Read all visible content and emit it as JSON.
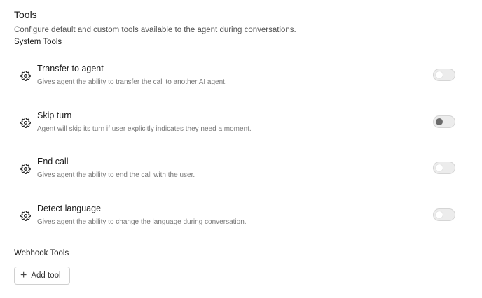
{
  "header": {
    "title": "Tools",
    "description": "Configure default and custom tools available to the agent during conversations."
  },
  "system_tools": {
    "title": "System Tools",
    "items": [
      {
        "name": "Transfer to agent",
        "description": "Gives agent the ability to transfer the call to another AI agent.",
        "enabled": false,
        "icon": "gear-icon"
      },
      {
        "name": "Skip turn",
        "description": "Agent will skip its turn if user explicitly indicates they need a moment.",
        "enabled": false,
        "icon": "gear-icon"
      },
      {
        "name": "End call",
        "description": "Gives agent the ability to end the call with the user.",
        "enabled": false,
        "icon": "gear-icon"
      },
      {
        "name": "Detect language",
        "description": "Gives agent the ability to change the language during conversation.",
        "enabled": false,
        "icon": "gear-icon"
      }
    ]
  },
  "webhook_tools": {
    "title": "Webhook Tools",
    "add_label": "Add tool",
    "add_icon": "plus-icon"
  }
}
